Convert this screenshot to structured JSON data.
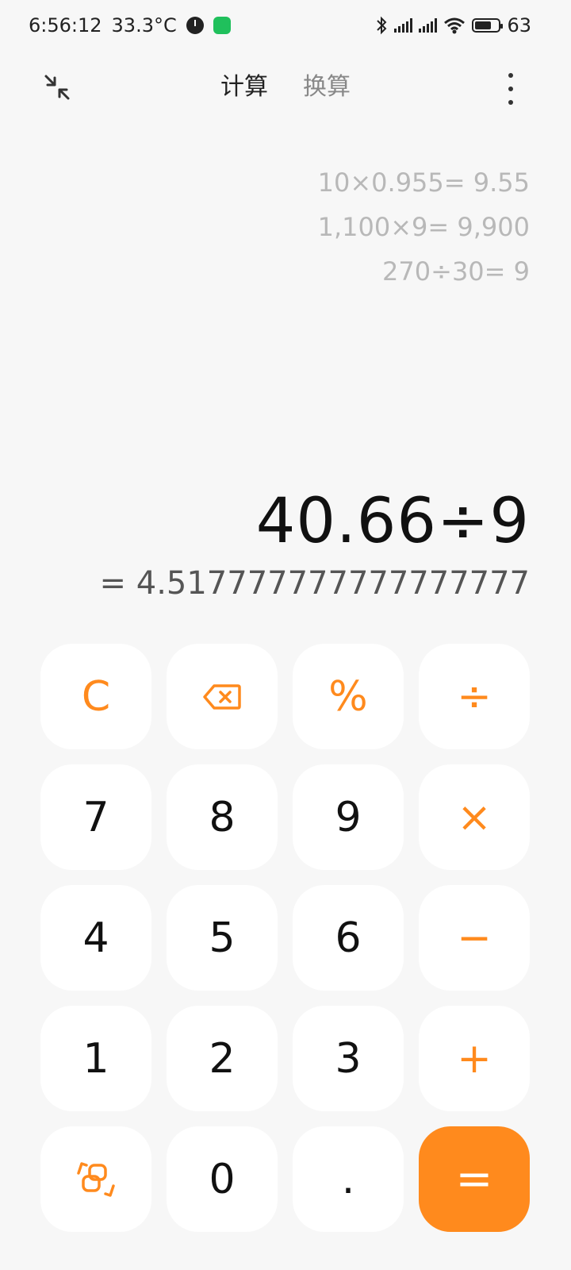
{
  "status": {
    "time": "6:56:12",
    "temperature": "33.3°C",
    "battery": "63",
    "icons": [
      "clock-app-icon",
      "wechat-icon",
      "bluetooth-icon",
      "signal-icon",
      "signal-icon",
      "wifi-icon",
      "battery-icon"
    ]
  },
  "header": {
    "tabs": [
      {
        "label": "计算",
        "active": true
      },
      {
        "label": "换算",
        "active": false
      }
    ]
  },
  "history": [
    "10×0.955= 9.55",
    "1,100×9= 9,900",
    "270÷30= 9"
  ],
  "display": {
    "expression": "40.66÷9",
    "result": "= 4.517777777777777777"
  },
  "keys": {
    "clear": "C",
    "percent": "%",
    "divide": "÷",
    "seven": "7",
    "eight": "8",
    "nine": "9",
    "multiply": "×",
    "four": "4",
    "five": "5",
    "six": "6",
    "minus": "−",
    "one": "1",
    "two": "2",
    "three": "3",
    "plus": "+",
    "zero": "0",
    "dot": ".",
    "equals": "="
  },
  "colors": {
    "accent": "#ff8a1d",
    "background": "#f7f7f7",
    "key_background": "#ffffff"
  }
}
